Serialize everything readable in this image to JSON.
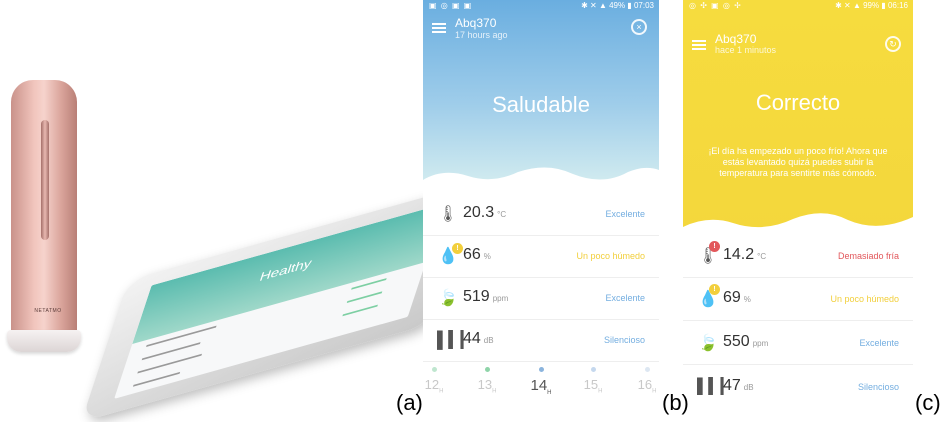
{
  "panel_a": {
    "device_brand": "NETATMO",
    "phone_screen_title": "Healthy"
  },
  "panel_b": {
    "status_time": "07:03",
    "status_battery": "49%",
    "station_name": "Abq370",
    "last_update": "17 hours ago",
    "state_title": "Saludable",
    "colors": {
      "sky_top": "#6aaee0",
      "sky_bottom": "#d6eef0",
      "status_ok": "#74aee0",
      "status_warn": "#f2cf3c"
    },
    "metrics": [
      {
        "icon": "thermometer-icon",
        "value": "20.3",
        "unit": "°C",
        "status": "Excelente"
      },
      {
        "icon": "humidity-drop-icon",
        "value": "66",
        "unit": "%",
        "status": "Un poco húmedo"
      },
      {
        "icon": "leaf-co2-icon",
        "value": "519",
        "unit": "ppm",
        "status": "Excelente"
      },
      {
        "icon": "noise-bars-icon",
        "value": "44",
        "unit": "dB",
        "status": "Silencioso"
      }
    ],
    "timeline": [
      {
        "label": "12",
        "sub": "H"
      },
      {
        "label": "13",
        "sub": "H"
      },
      {
        "label": "14",
        "sub": "H"
      },
      {
        "label": "15",
        "sub": "H"
      },
      {
        "label": "16",
        "sub": "H"
      }
    ]
  },
  "panel_c": {
    "status_time": "06:16",
    "status_battery": "99%",
    "station_name": "Abq370",
    "last_update": "hace 1 minutos",
    "state_title": "Correcto",
    "advice": "¡El día ha empezado un poco frío! Ahora que estás levantado quizá puedes subir la temperatura para sentirte más cómodo.",
    "colors": {
      "bg": "#f5d93c",
      "status_bad": "#e2575b",
      "status_warn": "#f2cf3c",
      "status_ok": "#74aee0"
    },
    "metrics": [
      {
        "icon": "thermometer-icon",
        "value": "14.2",
        "unit": "°C",
        "status": "Demasiado fría"
      },
      {
        "icon": "humidity-drop-icon",
        "value": "69",
        "unit": "%",
        "status": "Un poco húmedo"
      },
      {
        "icon": "leaf-co2-icon",
        "value": "550",
        "unit": "ppm",
        "status": "Excelente"
      },
      {
        "icon": "noise-bars-icon",
        "value": "47",
        "unit": "dB",
        "status": "Silencioso"
      }
    ]
  },
  "captions": {
    "a": "(a)",
    "b": "(b)",
    "c": "(c)"
  }
}
